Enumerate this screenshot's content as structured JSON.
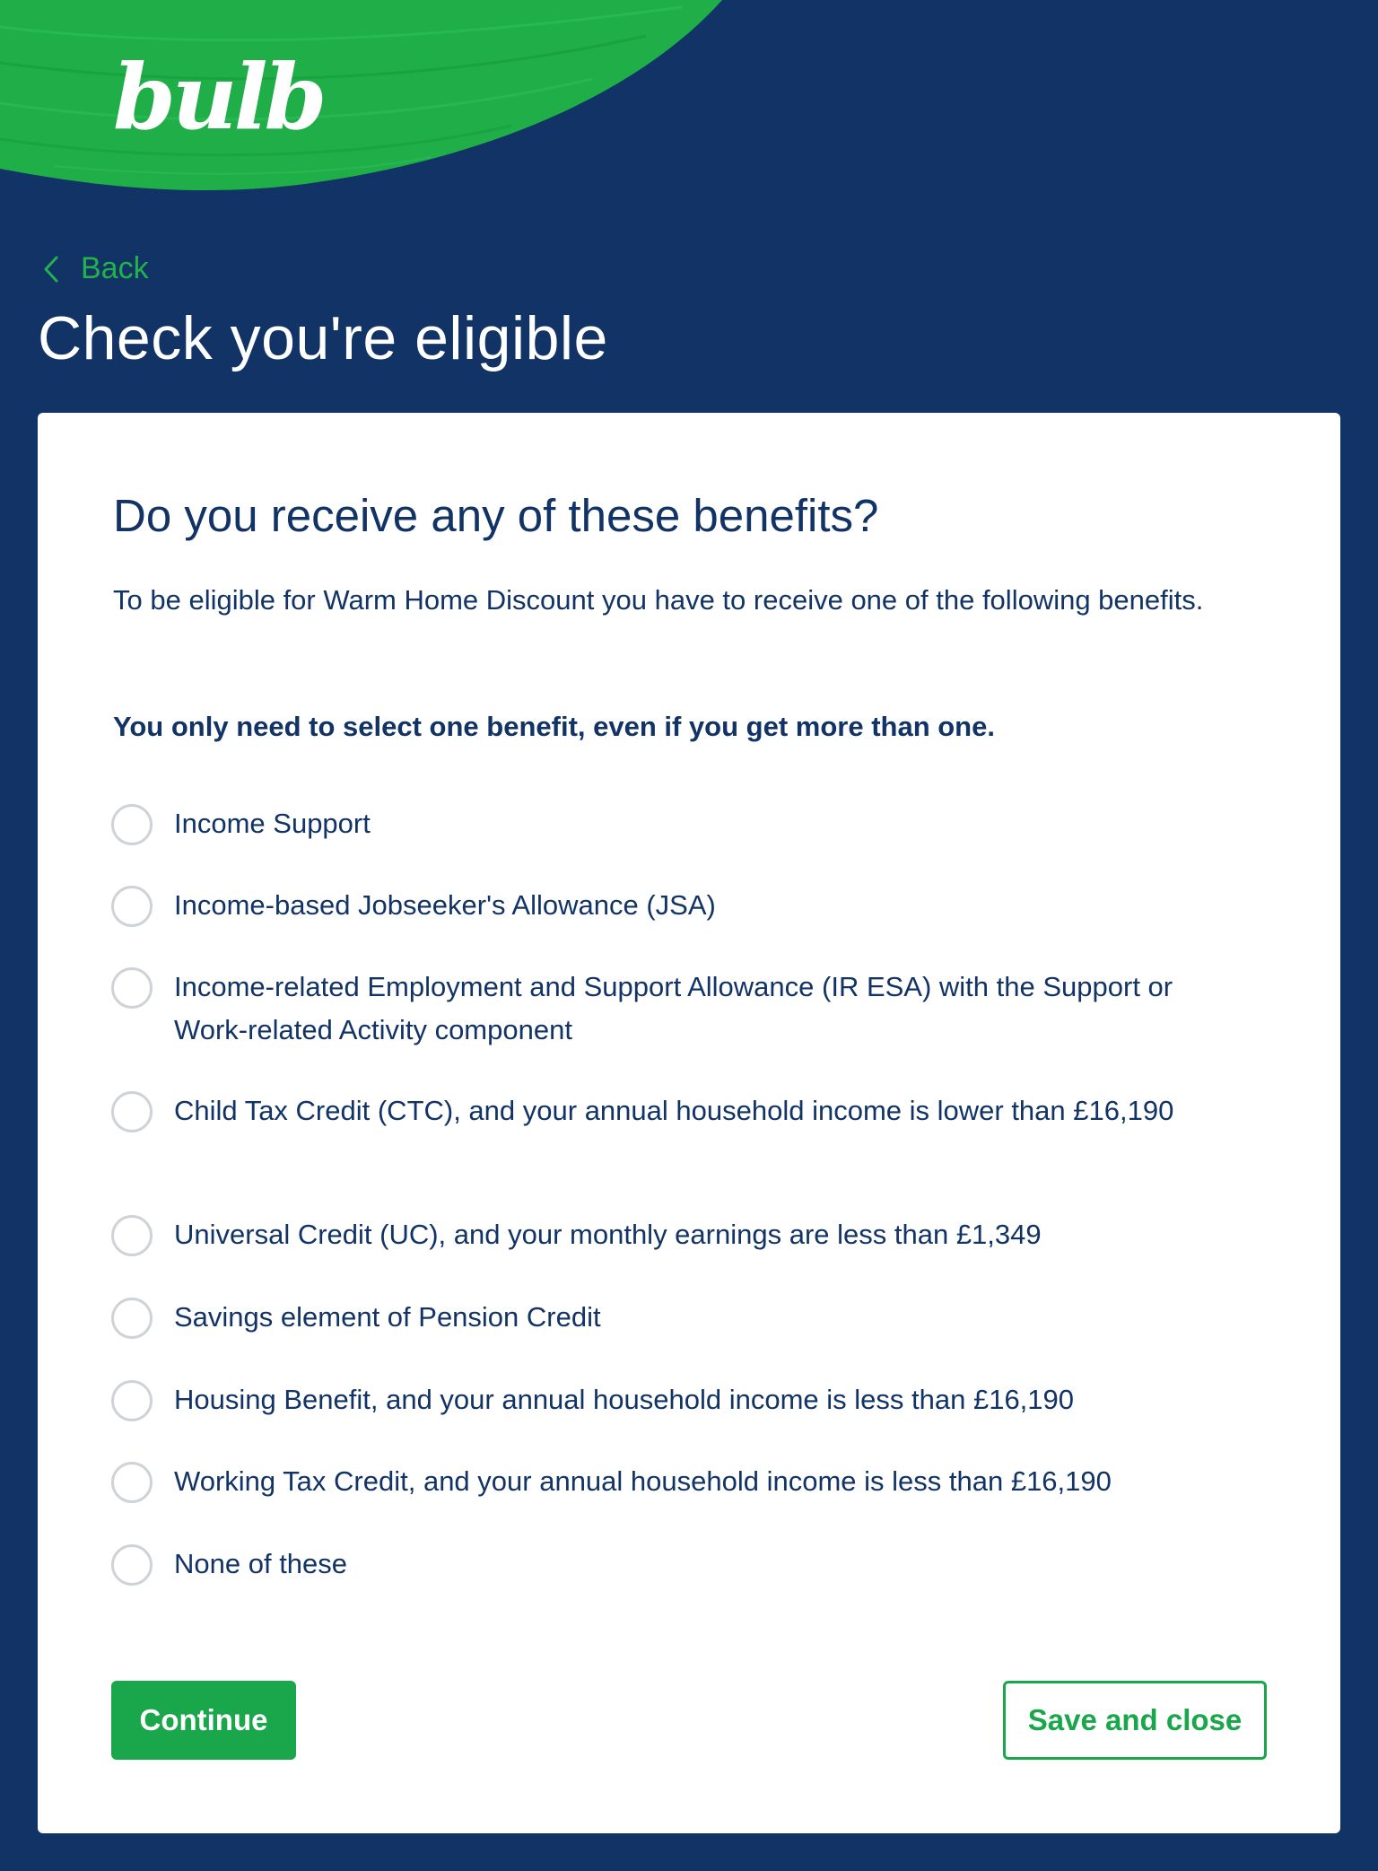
{
  "brand": {
    "logo_text": "bulb",
    "colors": {
      "navy": "#123365",
      "green": "#1aa64a",
      "brush_green": "#22b24c",
      "white": "#ffffff"
    }
  },
  "header": {
    "back_label": "Back",
    "title": "Check you're eligible"
  },
  "form": {
    "question": "Do you receive any of these benefits?",
    "intro": "To be eligible for Warm Home Discount you have to receive one of the following benefits.",
    "instruction": "You only need to select one benefit, even if you get more than one.",
    "options": [
      {
        "label": "Income Support",
        "selected": false
      },
      {
        "label": "Income-based Jobseeker's Allowance (JSA)",
        "selected": false
      },
      {
        "label": "Income-related Employment and Support Allowance (IR ESA) with the Support or Work-related Activity component",
        "selected": false
      },
      {
        "label": "Child Tax Credit (CTC), and your annual household income is lower than £16,190",
        "selected": false
      },
      {
        "label": "Universal Credit (UC), and your monthly earnings are less than £1,349",
        "selected": false
      },
      {
        "label": "Savings element of Pension Credit",
        "selected": false
      },
      {
        "label": "Housing Benefit, and your annual household income is less than £16,190",
        "selected": false
      },
      {
        "label": "Working Tax Credit, and your annual household income is less than £16,190",
        "selected": false
      },
      {
        "label": "None of these",
        "selected": false
      }
    ],
    "continue_label": "Continue",
    "save_label": "Save and close"
  }
}
